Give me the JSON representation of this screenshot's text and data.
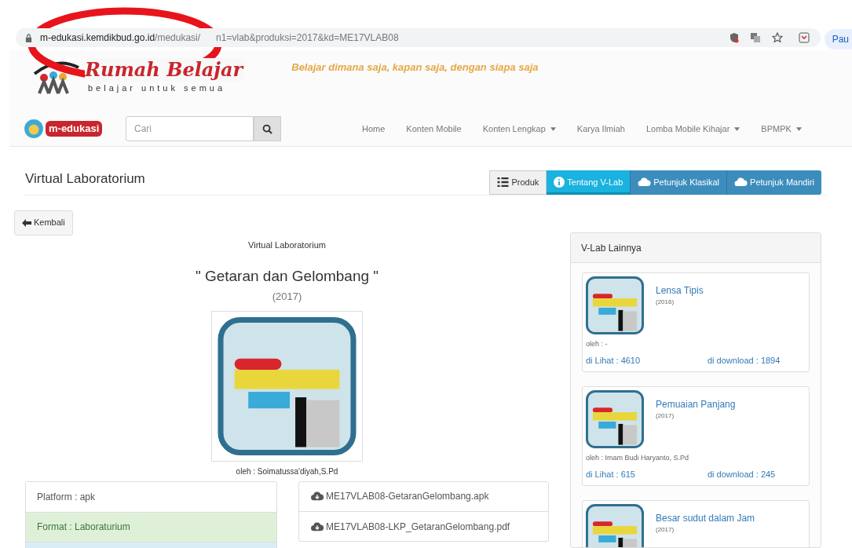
{
  "browser": {
    "url_host": "m-edukasi.kemdikbud.go.id",
    "url_path": "/medukasi/",
    "url_rest": "n1=vlab&produksi=2017&kd=ME17VLAB08",
    "profile": "Pau"
  },
  "header": {
    "logo_title": "Rumah Belajar",
    "logo_subtitle": "belajar untuk semua",
    "tagline": "Belajar dimana saja, kapan saja, dengan siapa saja"
  },
  "navbar": {
    "brand": "m-edukasi",
    "search": {
      "placeholder": "Cari"
    },
    "items": [
      {
        "label": "Home",
        "dropdown": false
      },
      {
        "label": "Konten Mobile",
        "dropdown": false
      },
      {
        "label": "Konten Lengkap",
        "dropdown": true
      },
      {
        "label": "Karya Ilmiah",
        "dropdown": false
      },
      {
        "label": "Lomba Mobile Kihajar",
        "dropdown": true
      },
      {
        "label": "BPMPK",
        "dropdown": true
      }
    ]
  },
  "page": {
    "title": "Virtual Laboratorium",
    "tabs": [
      {
        "label": "Produk",
        "kind": "list",
        "selected": false
      },
      {
        "label": "Tentang V-Lab",
        "kind": "info",
        "selected": true
      },
      {
        "label": "Petunjuk Klasikal",
        "kind": "cloud",
        "selected": false
      },
      {
        "label": "Petunjuk Mandiri",
        "kind": "cloud",
        "selected": false
      }
    ],
    "back": "Kembali"
  },
  "detail": {
    "category": "Virtual Laboratorium",
    "title": "\" Getaran dan Gelombang \"",
    "year": "(2017)",
    "author": "oleh : Soimatussa'diyah,S.Pd",
    "info": [
      {
        "text": "Platform : apk",
        "kind": "default"
      },
      {
        "text": "Format : Laboraturium",
        "kind": "success"
      },
      {
        "kind": "info"
      }
    ],
    "files": [
      "ME17VLAB08-GetaranGelombang.apk",
      "ME17VLAB08-LKP_GetaranGelombang.pdf"
    ]
  },
  "sidebar": {
    "title": "V-Lab Lainnya",
    "items": [
      {
        "title": "Lensa Tipis",
        "year": "(2016)",
        "author": "oleh : -",
        "views": "di Lihat : 4610",
        "downloads": "di download : 1894"
      },
      {
        "title": "Pemuaian Panjang",
        "year": "(2017)",
        "author": "oleh : Imam Budi Haryanto, S.Pd",
        "views": "di Lihat : 615",
        "downloads": "di download : 245"
      },
      {
        "title": "Besar sudut dalam Jam",
        "year": "(2017)"
      }
    ]
  }
}
